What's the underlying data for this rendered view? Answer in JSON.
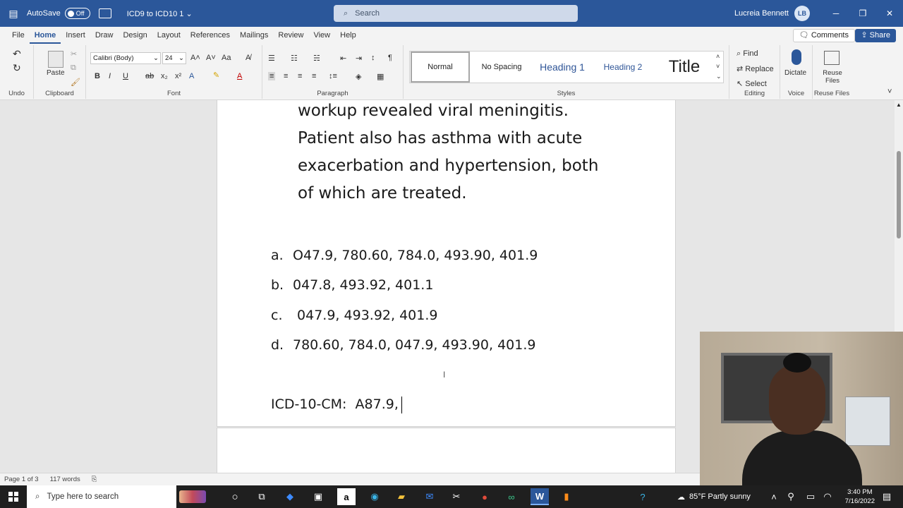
{
  "titlebar": {
    "autosave_label": "AutoSave",
    "autosave_state": "Off",
    "doc_title": "ICD9 to ICD10 1",
    "doc_title_chevron": "⌄",
    "search_placeholder": "Search",
    "user_name": "Lucreia Bennett",
    "user_initials": "LB",
    "minimize": "─",
    "restore": "❐",
    "close": "✕"
  },
  "menu": {
    "tabs": [
      "File",
      "Home",
      "Insert",
      "Draw",
      "Design",
      "Layout",
      "References",
      "Mailings",
      "Review",
      "View",
      "Help"
    ],
    "comments_label": "Comments",
    "share_label": "Share"
  },
  "ribbon": {
    "undo_label": "Undo",
    "clipboard_label": "Clipboard",
    "paste_label": "Paste",
    "font_label": "Font",
    "font_name": "Calibri (Body)",
    "font_size": "24",
    "paragraph_label": "Paragraph",
    "styles_label": "Styles",
    "styles": [
      "Normal",
      "No Spacing",
      "Heading 1",
      "Heading 2",
      "Title"
    ],
    "editing_label": "Editing",
    "find_label": "Find",
    "replace_label": "Replace",
    "select_label": "Select",
    "voice_label": "Voice",
    "dictate_label": "Dictate",
    "reuse_label": "Reuse Files",
    "reuse_btn": "Reuse Files"
  },
  "document": {
    "paragraph_lines": [
      "workup revealed viral meningitis.",
      "Patient also has asthma with acute",
      "exacerbation and hypertension, both",
      "of which are treated."
    ],
    "choices": [
      {
        "letter": "a.",
        "text": "O47.9, 780.60, 784.0, 493.90, 401.9"
      },
      {
        "letter": "b.",
        "text": "047.8, 493.92, 401.1"
      },
      {
        "letter": "c.",
        "text": " 047.9, 493.92, 401.9"
      },
      {
        "letter": "d.",
        "text": "780.60, 784.0, 047.9, 493.90, 401.9"
      }
    ],
    "answer_line": "ICD-10-CM:  A87.9,"
  },
  "status": {
    "page": "Page 1 of 3",
    "words": "117 words"
  },
  "taskbar": {
    "search_placeholder": "Type here to search",
    "weather": "85°F  Partly sunny",
    "time": "3:40 PM",
    "date": "7/16/2022"
  },
  "colors": {
    "word_blue": "#2b579a",
    "ribbon_bg": "#f3f3f3",
    "taskbar_bg": "#1f1f1f"
  }
}
